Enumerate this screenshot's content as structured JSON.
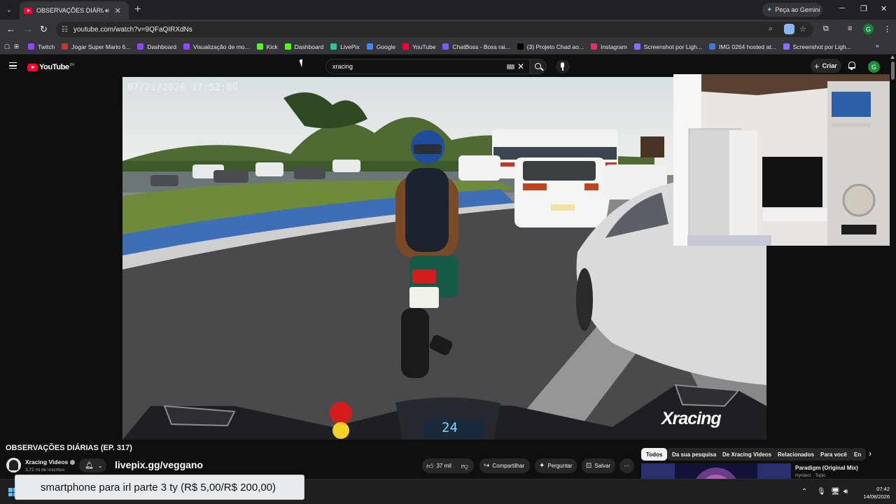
{
  "browser": {
    "tab": {
      "title": "OBSERVAÇÕES DIÁRIAS (EP."
    },
    "gemini_label": "Peça ao Gemini",
    "url": "youtube.com/watch?v=9QFaQIRXdNs",
    "profile_initial": "G",
    "bookmarks": [
      {
        "label": "Twitch",
        "color": "#9146ff"
      },
      {
        "label": "Jogar Super Mario 6...",
        "color": "#c0392b"
      },
      {
        "label": "Dashboard",
        "color": "#9146ff"
      },
      {
        "label": "Visualização de mo...",
        "color": "#9146ff"
      },
      {
        "label": "Kick",
        "color": "#53fc18"
      },
      {
        "label": "Dashboard",
        "color": "#53fc18"
      },
      {
        "label": "LivePix",
        "color": "#31c1a4"
      },
      {
        "label": "Google",
        "color": "#4285f4"
      },
      {
        "label": "YouTube",
        "color": "#ff0033"
      },
      {
        "label": "ChatBoss - Boss rai...",
        "color": "#7b5cff"
      },
      {
        "label": "(3) Projeto Chad ao...",
        "color": "#000000"
      },
      {
        "label": "Instagram",
        "color": "#e1306c"
      },
      {
        "label": "Screenshot por Ligh...",
        "color": "#8e6bff"
      },
      {
        "label": "IMG 0264 hosted at...",
        "color": "#3a7bd5"
      },
      {
        "label": "Screenshot por Ligh...",
        "color": "#8e6bff"
      }
    ]
  },
  "youtube": {
    "logo_text": "YouTube",
    "logo_country": "BR",
    "search_value": "xracing",
    "create_label": "Criar",
    "avatar_initial": "G",
    "video": {
      "overlay_timestamp": "07/21/2026   17:53:06",
      "speed_readout": "24",
      "watermark": "Xracing",
      "title": "OBSERVAÇÕES DIÁRIAS (EP. 317)"
    },
    "channel": {
      "name": "Xracing Videos",
      "subscribers": "3,72 mi de inscritos",
      "livepix_text": "livepix.gg/veggano"
    },
    "actions": {
      "likes": "37 mil",
      "share": "Compartilhar",
      "ask": "Perguntar",
      "save": "Salvar"
    },
    "chips": [
      "Todos",
      "Da sua pesquisa",
      "De Xracing Videos",
      "Relacionados",
      "Para você",
      "En"
    ],
    "related": {
      "title": "Paradigm (Original Mix)",
      "subtitle": "Hyrderz · Topic"
    }
  },
  "alert": {
    "text": "smartphone para irl parte 3 ty (R$ 5,00/R$ 200,00)"
  },
  "taskbar": {
    "time": "07:42",
    "date": "14/08/2026"
  }
}
